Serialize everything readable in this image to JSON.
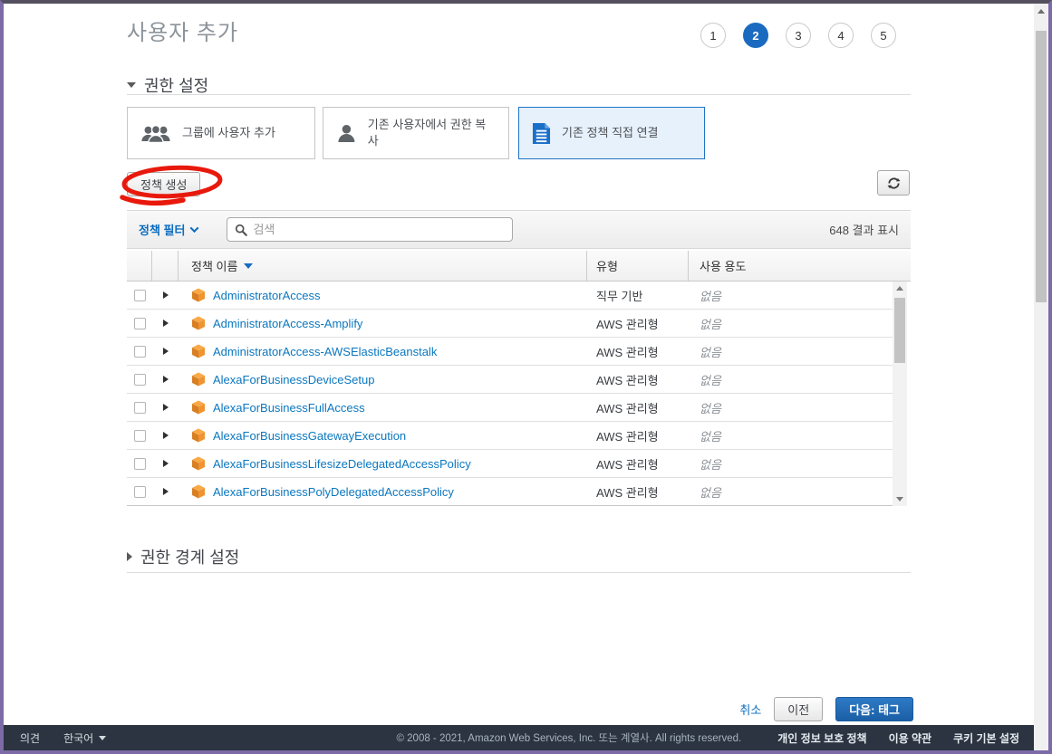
{
  "page": {
    "title": "사용자 추가"
  },
  "steps": {
    "labels": [
      "1",
      "2",
      "3",
      "4",
      "5"
    ],
    "active": "2"
  },
  "permissions": {
    "title": "권한 설정",
    "options": [
      {
        "label": "그룹에 사용자 추가",
        "icon": "group-icon",
        "selected": false
      },
      {
        "label": "기존 사용자에서 권한 복사",
        "icon": "user-icon",
        "selected": false
      },
      {
        "label": "기존 정책 직접 연결",
        "icon": "document-icon",
        "selected": true
      }
    ],
    "create_policy_label": "정책 생성"
  },
  "filter": {
    "label": "정책 필터",
    "search_placeholder": "검색",
    "results": "648 결과 표시"
  },
  "table": {
    "columns": {
      "name": "정책 이름",
      "type": "유형",
      "usage": "사용 용도"
    },
    "rows": [
      {
        "name": "AdministratorAccess",
        "type": "직무 기반",
        "usage": "없음"
      },
      {
        "name": "AdministratorAccess-Amplify",
        "type": "AWS 관리형",
        "usage": "없음"
      },
      {
        "name": "AdministratorAccess-AWSElasticBeanstalk",
        "type": "AWS 관리형",
        "usage": "없음"
      },
      {
        "name": "AlexaForBusinessDeviceSetup",
        "type": "AWS 관리형",
        "usage": "없음"
      },
      {
        "name": "AlexaForBusinessFullAccess",
        "type": "AWS 관리형",
        "usage": "없음"
      },
      {
        "name": "AlexaForBusinessGatewayExecution",
        "type": "AWS 관리형",
        "usage": "없음"
      },
      {
        "name": "AlexaForBusinessLifesizeDelegatedAccessPolicy",
        "type": "AWS 관리형",
        "usage": "없음"
      },
      {
        "name": "AlexaForBusinessPolyDelegatedAccessPolicy",
        "type": "AWS 관리형",
        "usage": "없음"
      }
    ]
  },
  "boundary": {
    "title": "권한 경계 설정"
  },
  "actions": {
    "cancel": "취소",
    "previous": "이전",
    "next": "다음: 태그"
  },
  "footer": {
    "feedback": "의견",
    "language": "한국어",
    "copyright": "© 2008 - 2021, Amazon Web Services, Inc. 또는 계열사. All rights reserved.",
    "links": [
      "개인 정보 보호 정책",
      "이용 약관",
      "쿠키 기본 설정"
    ]
  },
  "colors": {
    "accent_blue": "#1a6bbf",
    "link_blue": "#0b6dbf",
    "annotation_red": "#e8190c",
    "footer_bg": "#2b3440",
    "policy_cube_orange": "#ef9430"
  }
}
